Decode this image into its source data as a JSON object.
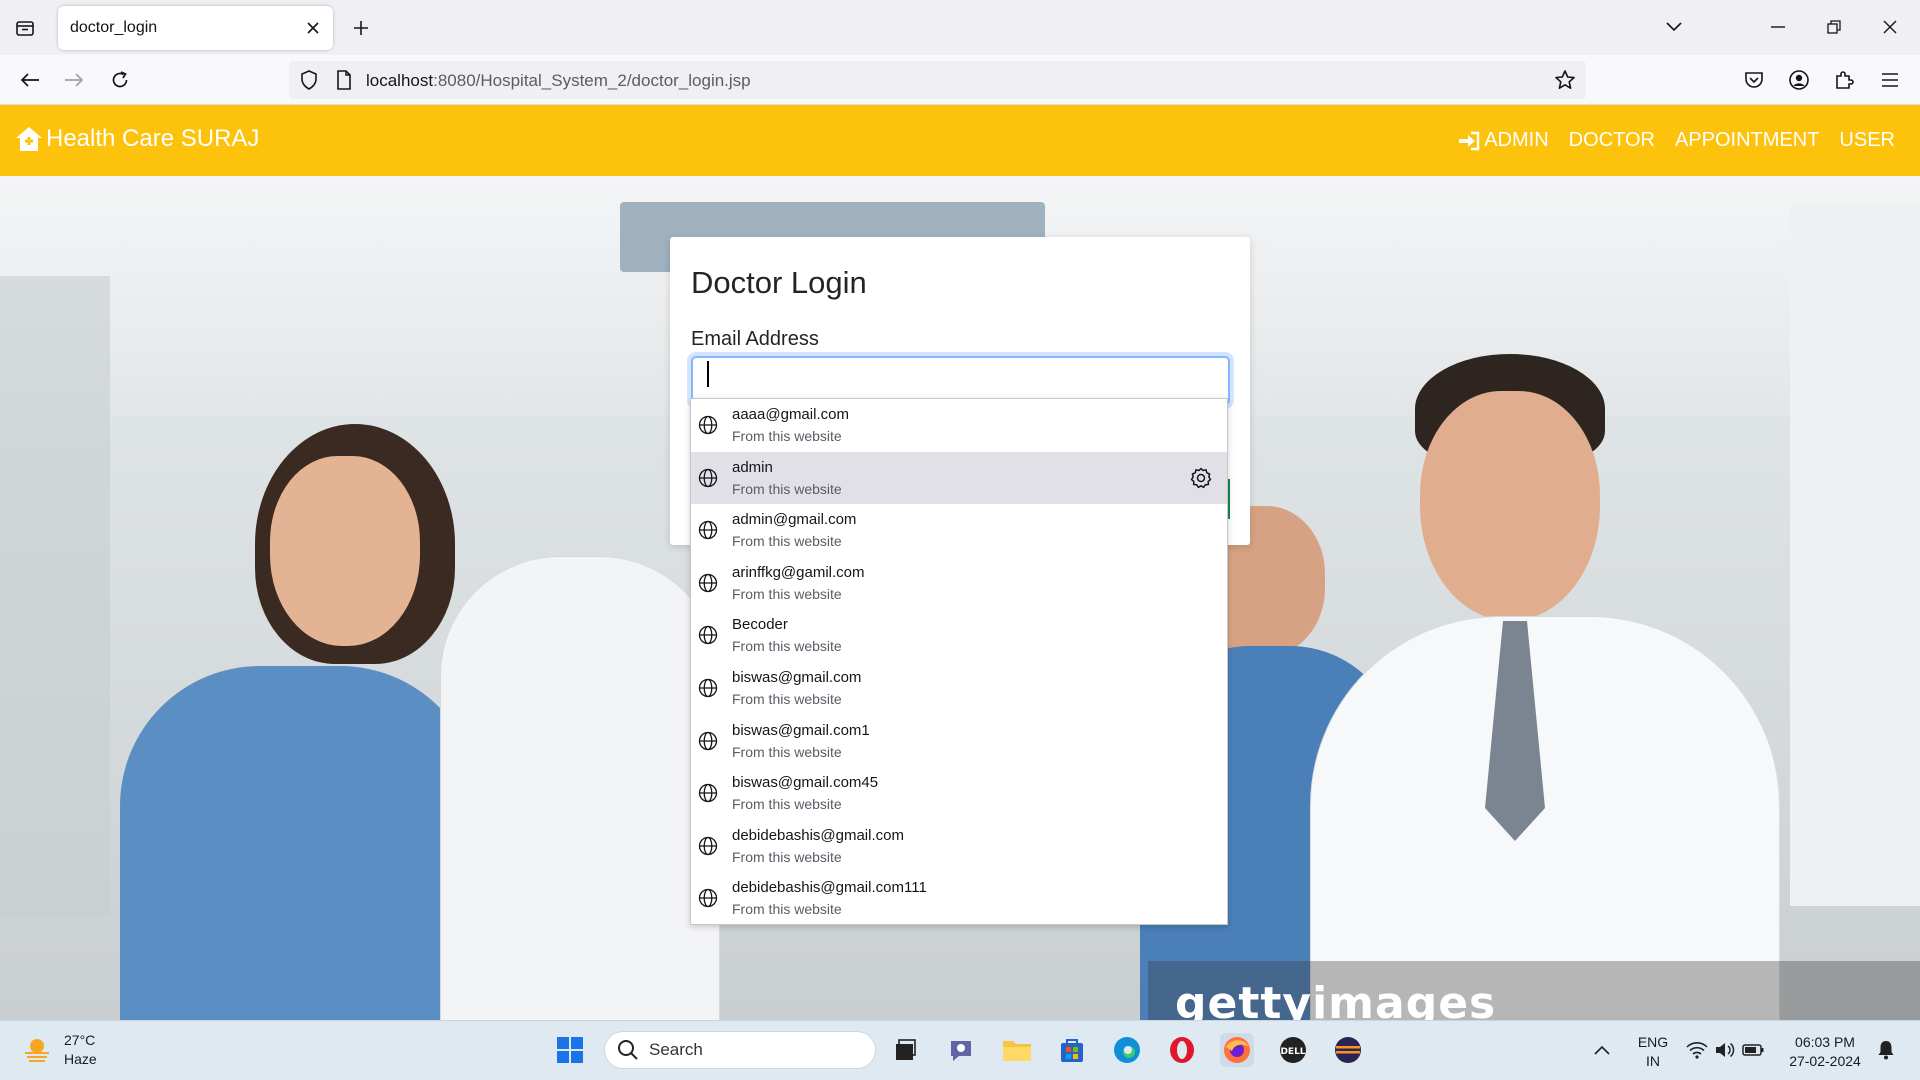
{
  "browser": {
    "tab_title": "doctor_login",
    "url_host": "localhost",
    "url_rest": ":8080/Hospital_System_2/doctor_login.jsp"
  },
  "site": {
    "brand": "Health Care SURAJ",
    "nav": {
      "admin": "ADMIN",
      "doctor": "DOCTOR",
      "appointment": "APPOINTMENT",
      "user": "USER"
    },
    "brand_color": "#fdc20c"
  },
  "login": {
    "title": "Doctor Login",
    "email_label": "Email Address",
    "email_value": ""
  },
  "autocomplete": {
    "items": [
      {
        "value": "aaaa@gmail.com",
        "source": "From this website"
      },
      {
        "value": "admin",
        "source": "From this website"
      },
      {
        "value": "admin@gmail.com",
        "source": "From this website"
      },
      {
        "value": "arinffkg@gamil.com",
        "source": "From this website"
      },
      {
        "value": "Becoder",
        "source": "From this website"
      },
      {
        "value": "biswas@gmail.com",
        "source": "From this website"
      },
      {
        "value": "biswas@gmail.com1",
        "source": "From this website"
      },
      {
        "value": "biswas@gmail.com45",
        "source": "From this website"
      },
      {
        "value": "debidebashis@gmail.com",
        "source": "From this website"
      },
      {
        "value": "debidebashis@gmail.com111",
        "source": "From this website"
      }
    ],
    "highlighted_index": 1
  },
  "watermark": "gettyimages",
  "taskbar": {
    "temperature": "27°C",
    "condition": "Haze",
    "search_label": "Search",
    "lang_top": "ENG",
    "lang_bottom": "IN",
    "time": "06:03 PM",
    "date": "27-02-2024"
  }
}
